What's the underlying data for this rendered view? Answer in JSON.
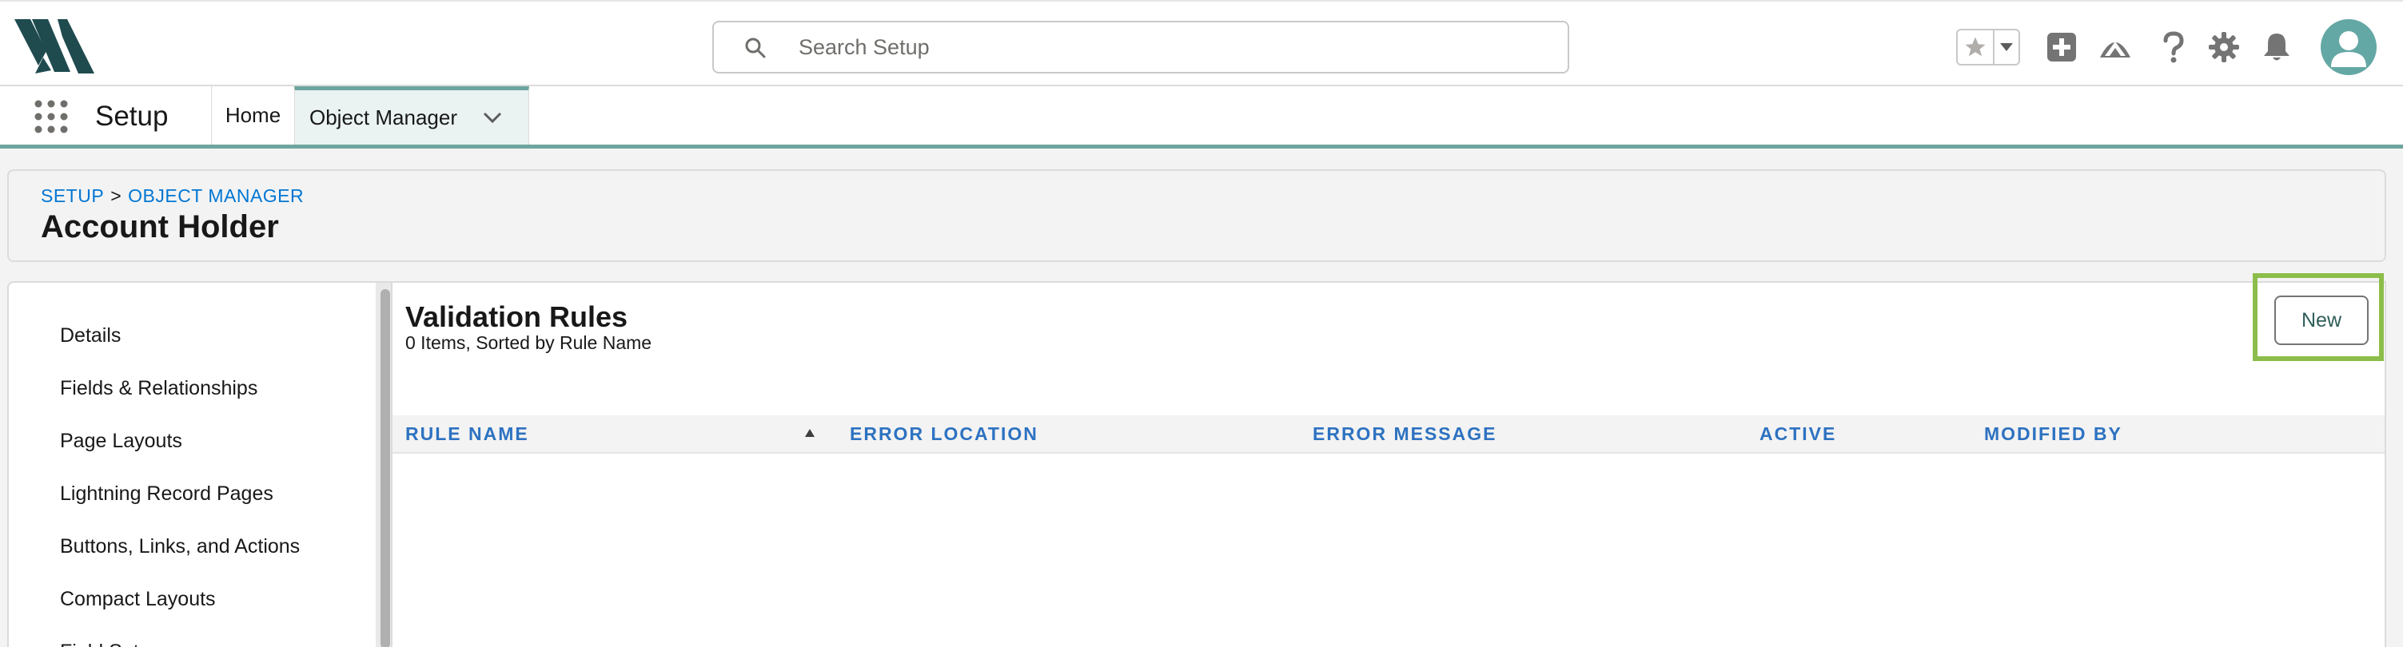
{
  "header": {
    "search_placeholder": "Search Setup",
    "icons": [
      "favorites-star-icon",
      "favorites-menu-icon",
      "add-icon",
      "trailhead-icon",
      "help-icon",
      "setup-gear-icon",
      "notifications-bell-icon",
      "user-avatar"
    ]
  },
  "nav": {
    "app_name": "Setup",
    "tabs": [
      {
        "label": "Home",
        "active": false
      },
      {
        "label": "Object Manager",
        "active": true
      }
    ]
  },
  "page": {
    "breadcrumb": [
      "SETUP",
      ">",
      "OBJECT MANAGER"
    ],
    "title": "Account Holder"
  },
  "sidebar": {
    "items": [
      {
        "label": "Details"
      },
      {
        "label": "Fields & Relationships"
      },
      {
        "label": "Page Layouts"
      },
      {
        "label": "Lightning Record Pages"
      },
      {
        "label": "Buttons, Links, and Actions"
      },
      {
        "label": "Compact Layouts"
      },
      {
        "label": "Field Sets"
      }
    ]
  },
  "main": {
    "title": "Validation Rules",
    "subtitle": "0 Items, Sorted by Rule Name",
    "new_button": "New",
    "columns": [
      {
        "label": "RULE NAME",
        "sorted": "ascending"
      },
      {
        "label": "ERROR LOCATION"
      },
      {
        "label": "ERROR MESSAGE"
      },
      {
        "label": "ACTIVE"
      },
      {
        "label": "MODIFIED BY"
      }
    ],
    "rows": []
  },
  "colors": {
    "accent_teal": "#6fa5a0",
    "link_blue": "#0176d3",
    "column_header_blue": "#2d72c1",
    "highlight_green": "#8cbd4a",
    "logo_dark": "#1f4b4f"
  }
}
